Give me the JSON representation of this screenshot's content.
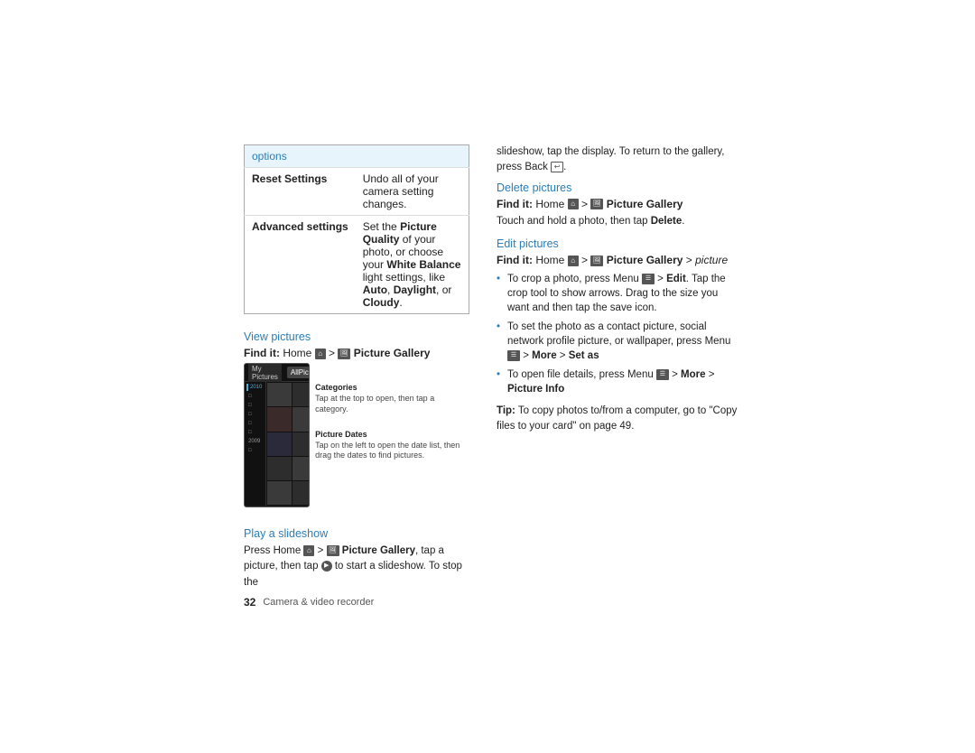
{
  "page": {
    "background": "#ffffff"
  },
  "options_table": {
    "header": "options",
    "rows": [
      {
        "label": "Reset Settings",
        "description": "Undo all of your camera setting changes."
      },
      {
        "label": "Advanced settings",
        "description": "Set the Picture Quality of your photo, or choose your White Balance light settings, like Auto, Daylight, or Cloudy."
      }
    ]
  },
  "left_column": {
    "view_pictures_title": "View pictures",
    "find_it_label": "Find it:",
    "find_it_text": "Home",
    "find_it_bold": "Picture Gallery",
    "play_slideshow_title": "Play a slideshow",
    "play_slideshow_body": "Press Home",
    "play_slideshow_bold": "Picture Gallery",
    "play_slideshow_cont": ", tap a picture, then tap",
    "play_slideshow_cont2": "to start a slideshow. To stop the",
    "page_number": "32",
    "page_description": "Camera & video recorder",
    "annotations": [
      {
        "title": "Categories",
        "body": "Tap at the top to open, then tap a category."
      },
      {
        "title": "Picture Dates",
        "body": "Tap on the left to open the date list, then drag the dates to find pictures."
      }
    ]
  },
  "right_column": {
    "slideshow_continue": "slideshow, tap the display. To return to the gallery, press Back",
    "delete_pictures_title": "Delete pictures",
    "delete_find_it_label": "Find it:",
    "delete_find_it_text": "Home",
    "delete_find_it_bold": "Picture Gallery",
    "touch_hold": "Touch and hold a photo, then tap",
    "touch_delete_bold": "Delete",
    "edit_pictures_title": "Edit pictures",
    "edit_find_it_label": "Find it:",
    "edit_find_it_text": "Home",
    "edit_find_it_bold": "Picture Gallery",
    "edit_find_it_italic": "picture",
    "bullets": [
      "To crop a photo, press Menu      > Edit. Tap the crop tool to show arrows. Drag to the size you want and then tap the save icon.",
      "To set the photo as a contact picture, social network profile picture, or wallpaper, press Menu      > More > Set as",
      "To open file details, press Menu      > More > Picture Info"
    ],
    "tip_label": "Tip:",
    "tip_body": "To copy photos to/from a computer, go to \"Copy files to your card\" on page 49."
  }
}
